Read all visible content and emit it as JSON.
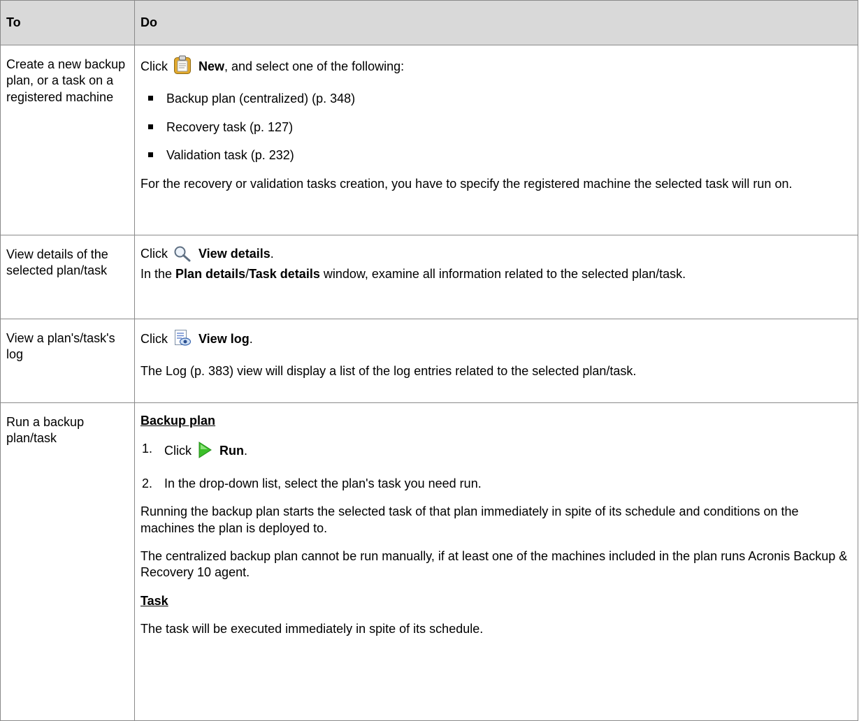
{
  "header": {
    "col1": "To",
    "col2": "Do"
  },
  "rows": [
    {
      "to": "Create a new backup plan, or a task on a registered machine",
      "click": "Click",
      "action": "New",
      "after": ", and select one of the following:",
      "icon": "clipboard-icon",
      "bullets": [
        "Backup plan (centralized) (p. 348)",
        "Recovery task (p. 127)",
        "Validation task (p. 232)"
      ],
      "note": "For the recovery or validation tasks creation, you have to specify the registered machine the selected task will run on."
    },
    {
      "to": "View details of the selected plan/task",
      "click": "Click",
      "action": "View details",
      "after": ".",
      "icon": "magnifier-icon",
      "l2a": "In the ",
      "l2b": "Plan details",
      "l2c": "/",
      "l2d": "Task details",
      "l2e": " window, examine all information related to the selected plan/task."
    },
    {
      "to": "View a plan's/task's log",
      "click": "Click",
      "action": "View log",
      "after": ".",
      "icon": "view-log-icon",
      "note": "The Log (p. 383) view will display a list of the log entries related to the selected plan/task."
    },
    {
      "to": "Run a backup plan/task",
      "heading1": "Backup plan",
      "step1_num": "1.",
      "step1_click": "Click",
      "step1_action": "Run",
      "step1_after": ".",
      "icon": "run-icon",
      "step2_num": "2.",
      "step2": "In the drop-down list, select the plan's task you need run.",
      "para1": "Running the backup plan starts the selected task of that plan immediately in spite of its schedule and conditions on the machines the plan is deployed to.",
      "para2": "The centralized backup plan cannot be run manually, if at least one of the machines included in the plan runs Acronis Backup & Recovery 10 agent.",
      "heading2": "Task",
      "para3": "The task will be executed immediately in spite of its schedule."
    }
  ]
}
